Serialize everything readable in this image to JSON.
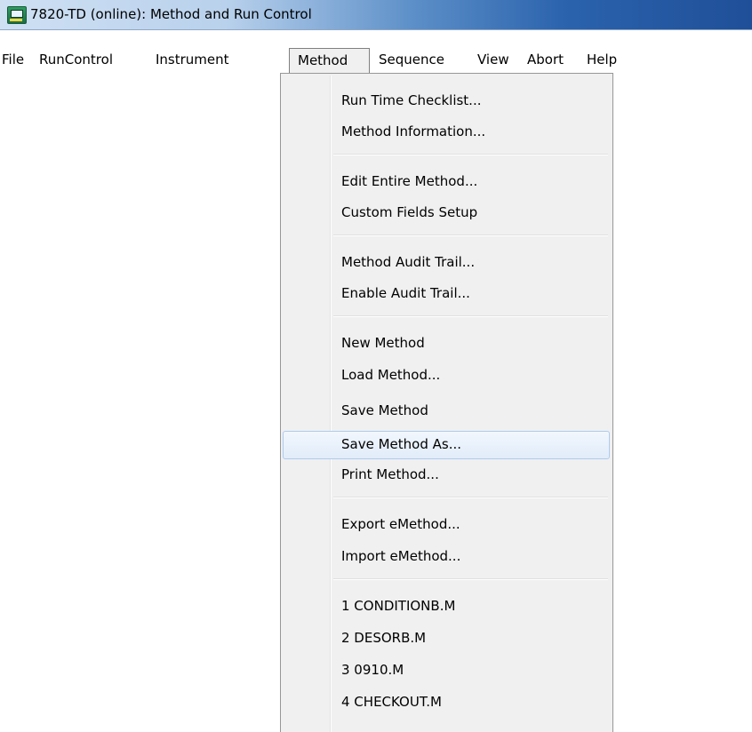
{
  "window": {
    "title": "7820-TD (online): Method and Run Control",
    "icon": "gc-instrument-icon"
  },
  "menubar": {
    "items": [
      {
        "label": "File"
      },
      {
        "label": "RunControl"
      },
      {
        "label": "Instrument"
      },
      {
        "label": "Method"
      },
      {
        "label": "Sequence"
      },
      {
        "label": "View"
      },
      {
        "label": "Abort"
      },
      {
        "label": "Help"
      }
    ],
    "open_menu": "Method"
  },
  "method_menu": {
    "groups": [
      [
        "Run Time Checklist...",
        "Method Information..."
      ],
      [
        "Edit Entire Method...",
        "Custom Fields Setup"
      ],
      [
        "Method Audit Trail...",
        "Enable Audit Trail..."
      ],
      [
        "New Method",
        "Load Method...",
        "Save Method",
        "Save Method As...",
        "Print Method..."
      ],
      [
        "Export eMethod...",
        "Import eMethod..."
      ],
      [
        "1 CONDITIONB.M",
        "2 DESORB.M",
        "3 0910.M",
        "4 CHECKOUT.M"
      ]
    ],
    "items": {
      "run_time_checklist": "Run Time Checklist...",
      "method_information": "Method Information...",
      "edit_entire_method": "Edit Entire Method...",
      "custom_fields_setup": "Custom Fields Setup",
      "method_audit_trail": "Method Audit Trail...",
      "enable_audit_trail": "Enable Audit Trail...",
      "new_method": "New Method",
      "load_method": "Load Method...",
      "save_method": "Save Method",
      "save_method_as": "Save Method As...",
      "print_method": "Print Method...",
      "export_emethod": "Export eMethod...",
      "import_emethod": "Import eMethod...",
      "recent_1": "1 CONDITIONB.M",
      "recent_2": "2 DESORB.M",
      "recent_3": "3 0910.M",
      "recent_4": "4 CHECKOUT.M"
    },
    "highlighted": "Save Method As..."
  },
  "colors": {
    "menu_background": "#f0f0f0",
    "highlight_fill": "#e1ecf9",
    "highlight_border": "#aecbee",
    "titlebar_dark": "#1f4f98"
  }
}
